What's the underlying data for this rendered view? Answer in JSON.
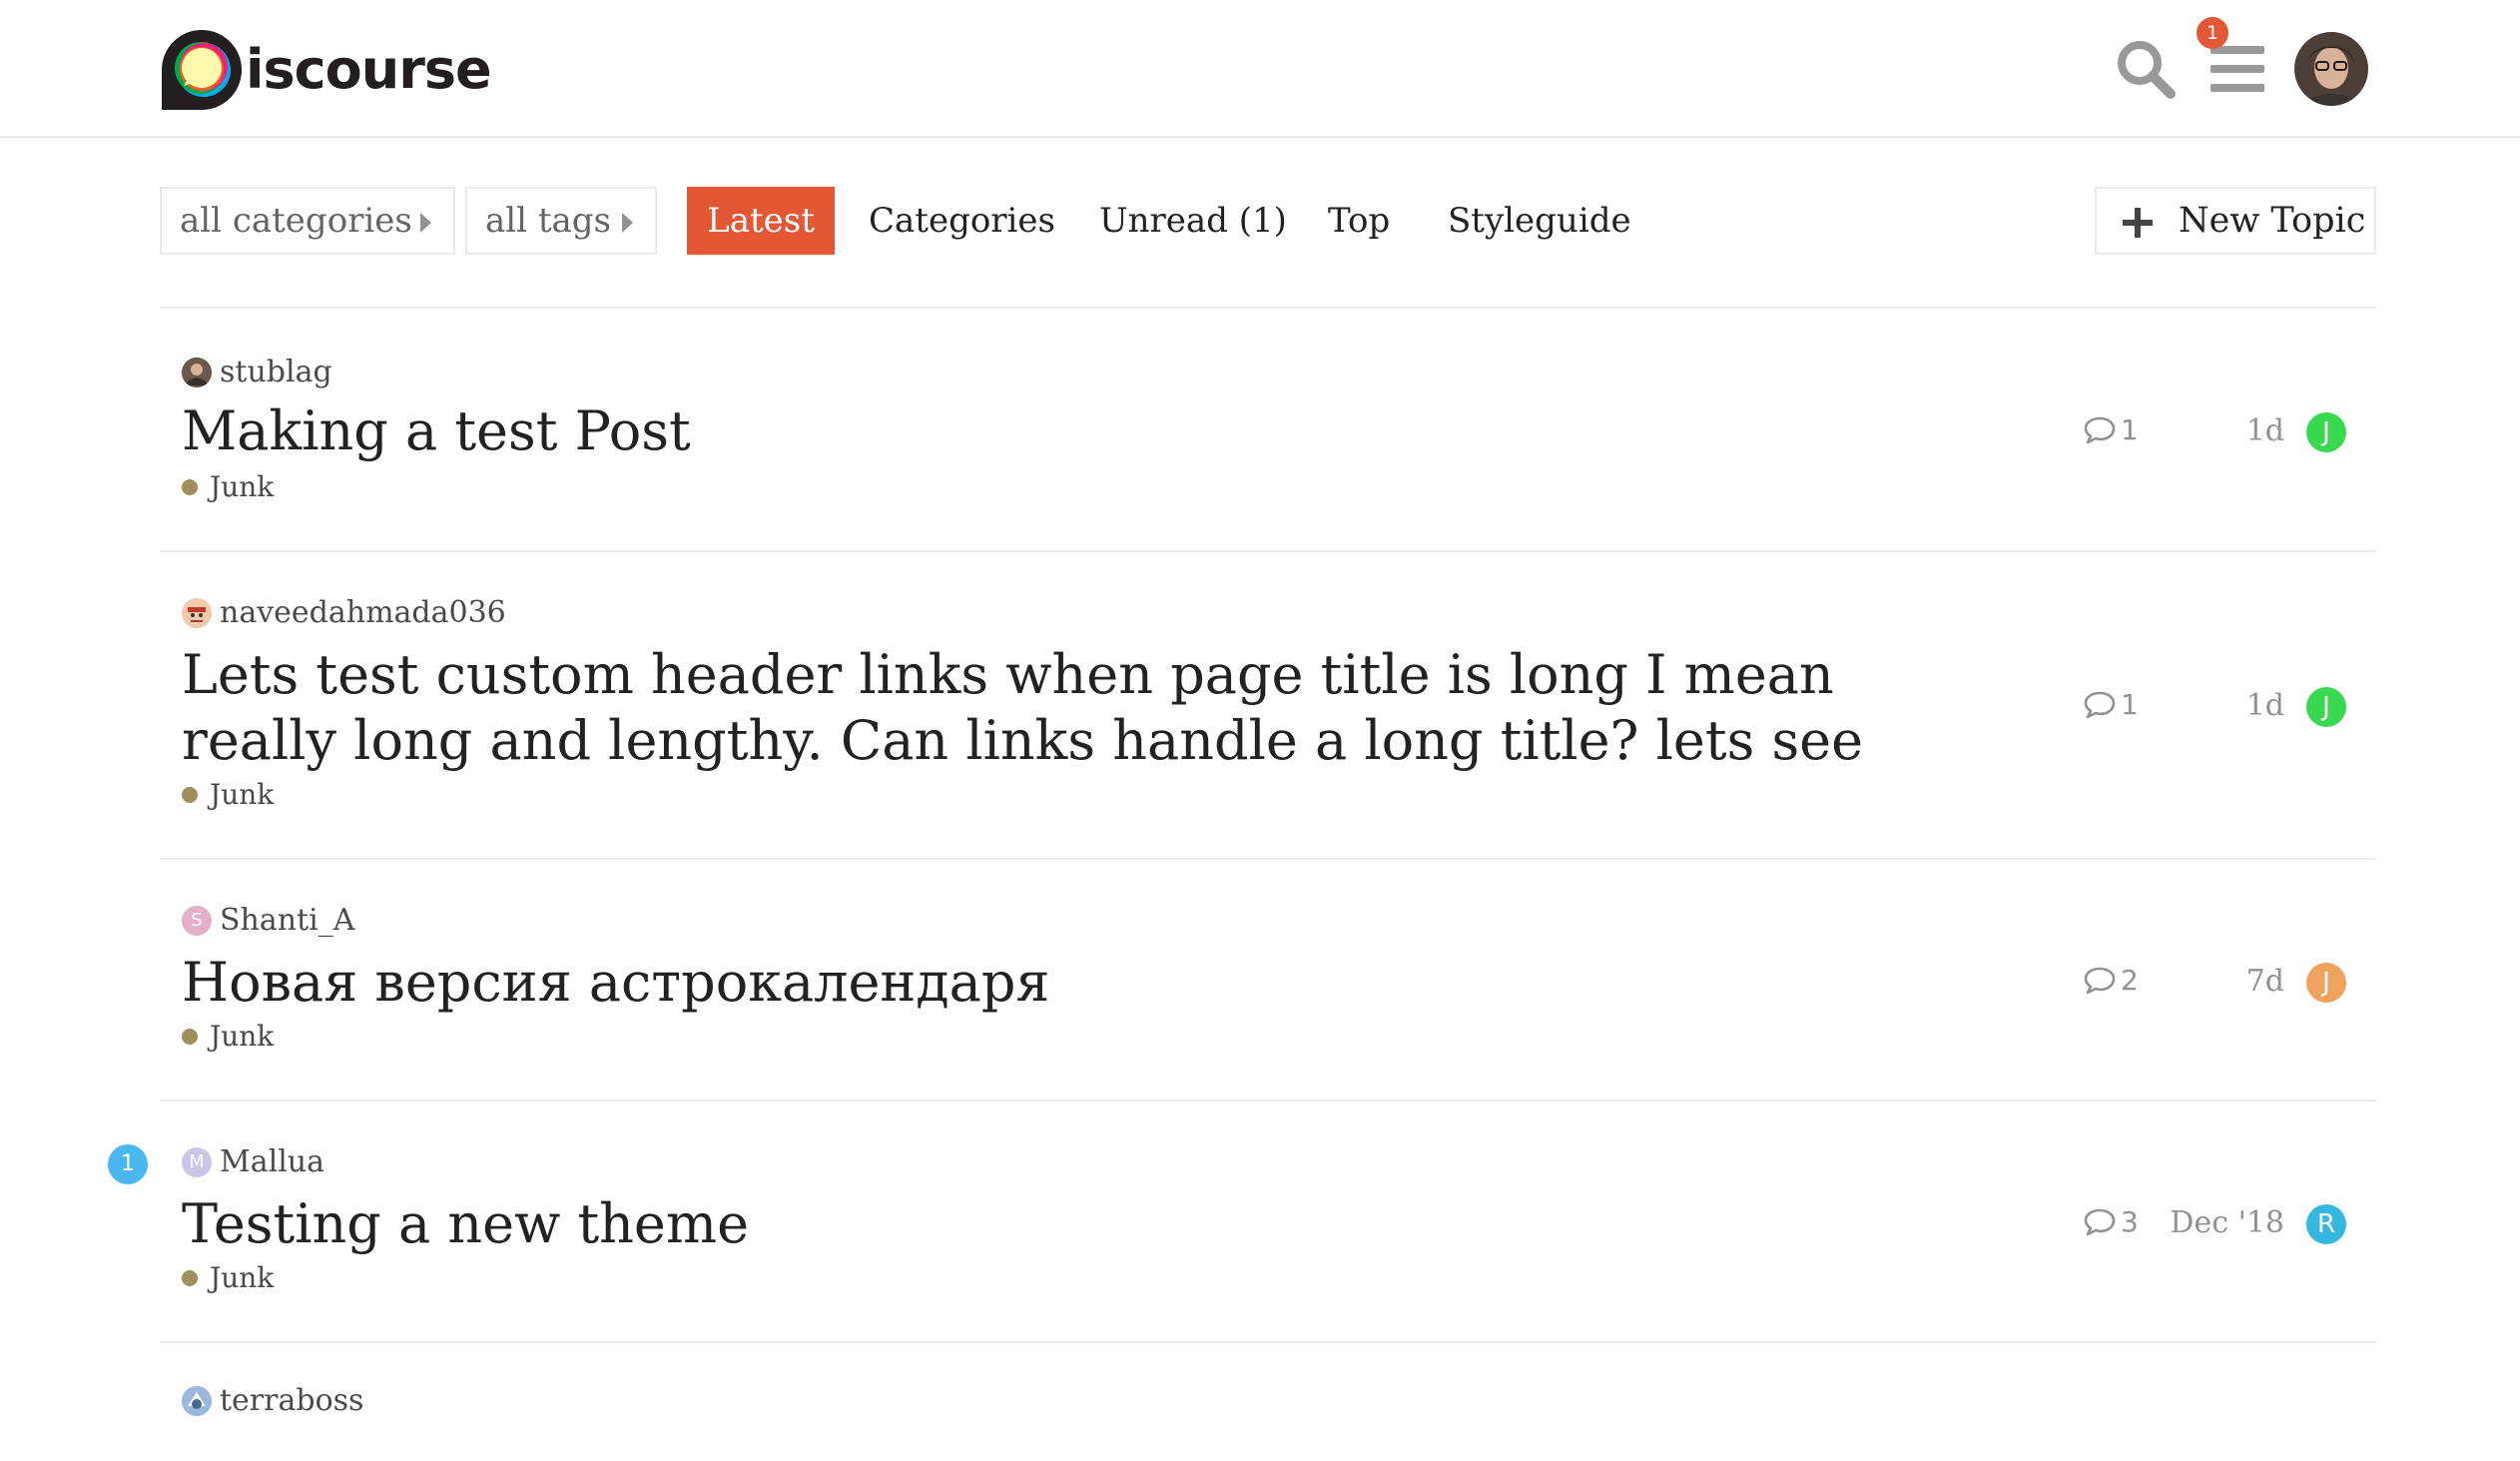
{
  "header": {
    "logo_text": "iscourse",
    "notification_count": "1",
    "icons": [
      "search-icon",
      "hamburger-menu-icon"
    ]
  },
  "nav": {
    "categories_dropdown": "all categories",
    "tags_dropdown": "all tags",
    "items": [
      "Latest",
      "Categories",
      "Unread (1)",
      "Top",
      "Styleguide"
    ],
    "active": "Latest",
    "new_topic": "New Topic"
  },
  "colors": {
    "accent": "#e45735",
    "category_junk": "#a08e5c",
    "unread_badge": "#4ab8f0"
  },
  "topics": [
    {
      "poster": "stublag",
      "title": "Making a test Post",
      "category": "Junk",
      "replies": "1",
      "activity": "1d",
      "last_poster_letter": "J",
      "last_poster_color": "#38d94f"
    },
    {
      "poster": "naveedahmada036",
      "title_line1": "Lets test custom header links when page title is long I mean",
      "title_line2": "really long and lengthy. Can links handle a long title? lets see",
      "category": "Junk",
      "replies": "1",
      "activity": "1d",
      "last_poster_letter": "J",
      "last_poster_color": "#38d94f"
    },
    {
      "poster": "Shanti_A",
      "poster_letter": "S",
      "title": "Новая версия астрокалендаря",
      "category": "Junk",
      "replies": "2",
      "activity": "7d",
      "last_poster_letter": "J",
      "last_poster_color": "#eea25e"
    },
    {
      "poster": "Mallua",
      "poster_letter": "M",
      "title": "Testing a new theme",
      "category": "Junk",
      "replies": "3",
      "activity": "Dec '18",
      "last_poster_letter": "R",
      "last_poster_color": "#35b8e0",
      "unread_count": "1"
    },
    {
      "poster": "terraboss"
    }
  ]
}
